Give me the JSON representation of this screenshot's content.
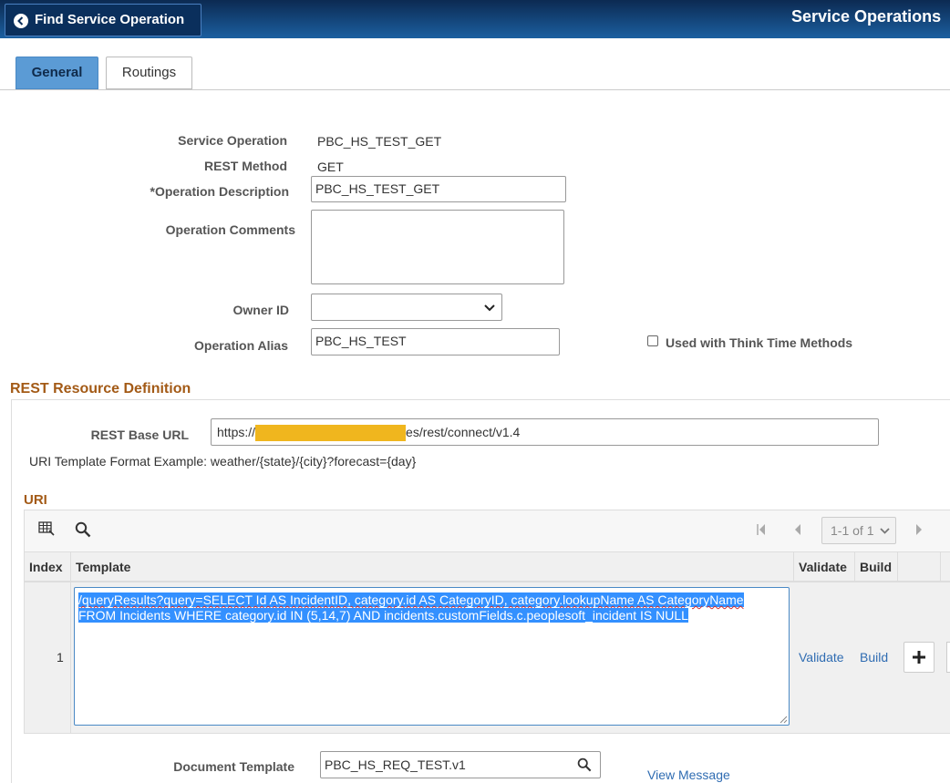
{
  "header": {
    "back_button_label": "Find Service Operation",
    "page_title": "Service Operations"
  },
  "tabs": [
    {
      "label": "General",
      "active": true
    },
    {
      "label": "Routings",
      "active": false
    }
  ],
  "form": {
    "service_operation_label": "Service Operation",
    "service_operation_value": "PBC_HS_TEST_GET",
    "rest_method_label": "REST Method",
    "rest_method_value": "GET",
    "operation_description_label": "*Operation Description",
    "operation_description_value": "PBC_HS_TEST_GET",
    "operation_comments_label": "Operation Comments",
    "operation_comments_value": "",
    "owner_id_label": "Owner ID",
    "owner_id_value": "",
    "operation_alias_label": "Operation Alias",
    "operation_alias_value": "PBC_HS_TEST",
    "think_time_label": "Used with Think Time Methods",
    "think_time_checked": false
  },
  "rest_resource": {
    "section_title": "REST Resource Definition",
    "base_url_label": "REST Base URL",
    "base_url_prefix": "https://",
    "base_url_suffix": "es/rest/connect/v1.4",
    "redaction_color": "#f0b61e",
    "uri_example": "URI Template Format Example: weather/{state}/{city}?forecast={day}"
  },
  "uri_grid": {
    "title": "URI",
    "pager_text": "1-1 of 1",
    "columns": {
      "index": "Index",
      "template": "Template",
      "validate": "Validate",
      "build": "Build"
    },
    "rows": [
      {
        "index": "1",
        "template_line1": "/queryResults?query=SELECT Id AS IncidentID, category.id AS CategoryID, category.lookupName AS CategoryName",
        "template_line2": "FROM Incidents WHERE category.id IN (5,14,7) AND incidents.customFields.c.peoplesoft_incident IS NULL",
        "validate_link": "Validate",
        "build_link": "Build"
      }
    ]
  },
  "document": {
    "template_label": "Document Template",
    "template_value": "PBC_HS_REQ_TEST.v1",
    "view_message_link": "View Message"
  },
  "colors": {
    "header_dark": "#0c2a52",
    "tab_active": "#5b9bd5",
    "section_title": "#a35a16",
    "link": "#2f6cb2",
    "selection": "#3390ff"
  }
}
